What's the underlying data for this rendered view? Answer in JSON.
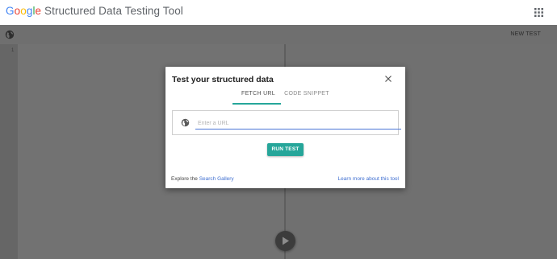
{
  "header": {
    "logo_google": [
      "G",
      "o",
      "o",
      "g",
      "l",
      "e"
    ],
    "logo_rest": " Structured Data Testing Tool",
    "apps_icon": "apps-grid-icon"
  },
  "toolbar": {
    "globe_icon": "globe-icon",
    "new_test_label": "NEW TEST"
  },
  "editor": {
    "line_number": "1"
  },
  "dialog": {
    "title": "Test your structured data",
    "tabs": [
      {
        "label": "FETCH URL",
        "active": true
      },
      {
        "label": "CODE SNIPPET",
        "active": false
      }
    ],
    "url_input": {
      "placeholder": "Enter a URL",
      "value": ""
    },
    "run_label": "RUN TEST",
    "footer_prefix": "Explore the ",
    "footer_link": "Search Gallery",
    "footer_right_link": "Learn more about this tool"
  },
  "colors": {
    "accent": "#26a69a",
    "link": "#3f6fd1",
    "overlay": "#6d6d6d"
  }
}
